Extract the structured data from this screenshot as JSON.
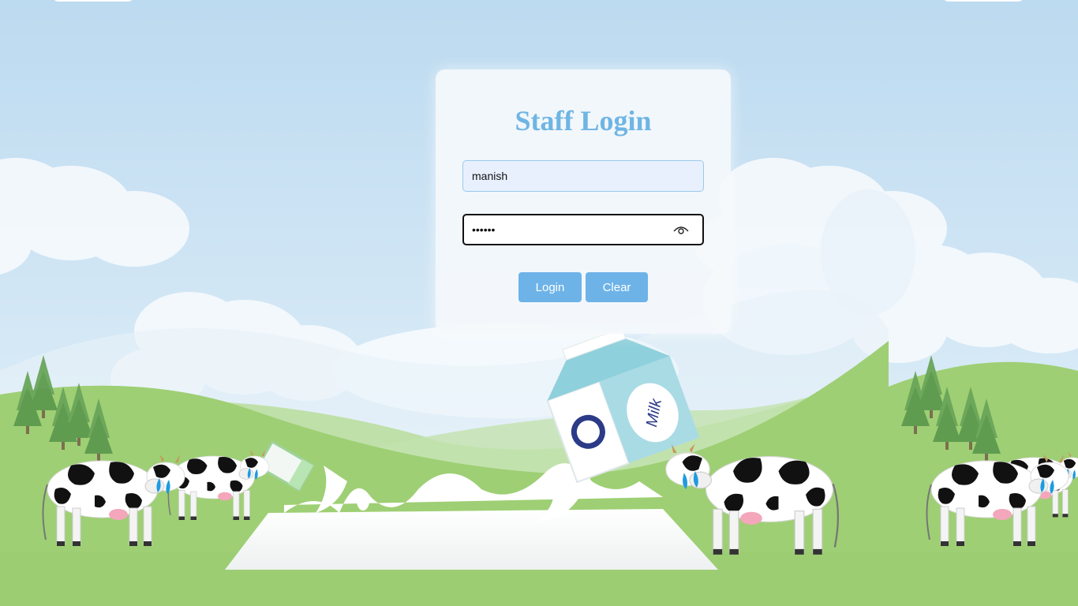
{
  "login": {
    "title": "Staff Login",
    "username_value": "manish",
    "password_value": "••••••",
    "login_label": "Login",
    "clear_label": "Clear",
    "toggle_icon": "eye-icon"
  },
  "background": {
    "carton_text": "Milk",
    "sky_color": "#bcdaf0",
    "grass_color": "#9ecf74",
    "accent_color": "#6db3e8"
  }
}
